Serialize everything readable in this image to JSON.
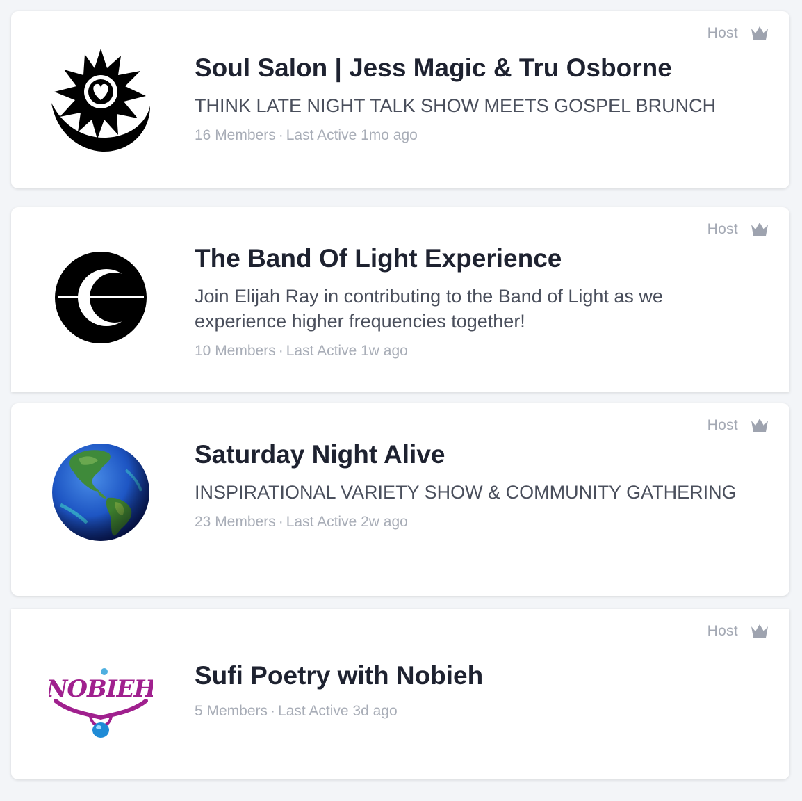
{
  "host_label": "Host",
  "colors": {
    "background": "#f3f5f8",
    "card": "#ffffff",
    "title": "#1e2230",
    "description": "#4a4f5c",
    "meta": "#a8adb7",
    "host": "#a4a9b4",
    "crown": "#9ea3af"
  },
  "groups": [
    {
      "title": "Soul Salon | Jess Magic & Tru Osborne",
      "description": "THINK LATE NIGHT TALK SHOW MEETS GOSPEL BRUNCH",
      "members": "16 Members",
      "separator": "·",
      "last_active": "Last Active 1mo ago",
      "logo": "sun-moon-heart-logo"
    },
    {
      "title": "The Band Of Light Experience",
      "description": "Join Elijah Ray in contributing to the Band of Light as we experience higher frequencies together!",
      "members": "10 Members",
      "separator": "·",
      "last_active": "Last Active 1w ago",
      "logo": "crescent-line-logo"
    },
    {
      "title": "Saturday Night Alive",
      "description": "INSPIRATIONAL VARIETY SHOW & COMMUNITY GATHERING",
      "members": "23 Members",
      "separator": "·",
      "last_active": "Last Active 2w ago",
      "logo": "earth-globe-logo"
    },
    {
      "title": "Sufi Poetry with Nobieh",
      "members": "5 Members",
      "separator": "·",
      "last_active": "Last Active 3d ago",
      "logo": "nobieh-logo",
      "logo_text": "NOBIEH"
    }
  ]
}
